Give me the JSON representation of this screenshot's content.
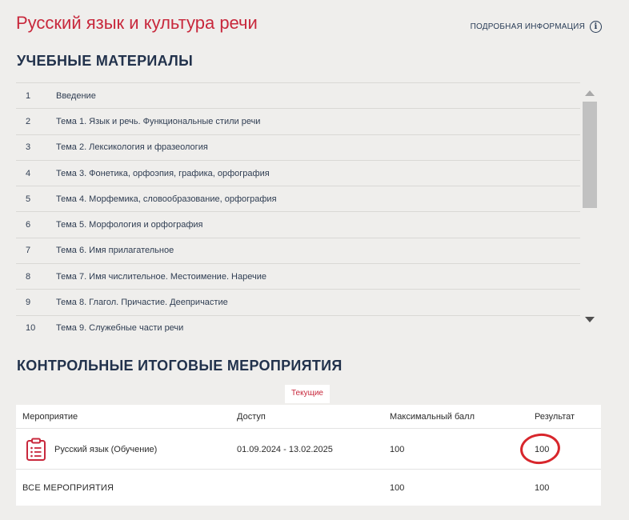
{
  "header": {
    "title": "Русский язык и культура речи",
    "info_label": "ПОДРОБНАЯ ИНФОРМАЦИЯ",
    "info_icon": "i"
  },
  "materials": {
    "title": "УЧЕБНЫЕ МАТЕРИАЛЫ",
    "items": [
      {
        "num": "1",
        "name": "Введение"
      },
      {
        "num": "2",
        "name": "Тема 1. Язык и речь. Функциональные стили речи"
      },
      {
        "num": "3",
        "name": "Тема 2. Лексикология и фразеология"
      },
      {
        "num": "4",
        "name": "Тема 3. Фонетика, орфоэпия, графика, орфография"
      },
      {
        "num": "5",
        "name": "Тема 4. Морфемика, словообразование, орфография"
      },
      {
        "num": "6",
        "name": "Тема 5. Морфология и орфография"
      },
      {
        "num": "7",
        "name": "Тема 6. Имя прилагательное"
      },
      {
        "num": "8",
        "name": "Тема 7. Имя числительное. Местоимение. Наречие"
      },
      {
        "num": "9",
        "name": "Тема 8. Глагол. Причастие. Деепричастие"
      },
      {
        "num": "10",
        "name": "Тема 9. Служебные части речи"
      }
    ]
  },
  "events": {
    "title": "КОНТРОЛЬНЫЕ ИТОГОВЫЕ МЕРОПРИЯТИЯ",
    "tab_label": "Текущие",
    "columns": [
      "Мероприятие",
      "Доступ",
      "Максимальный балл",
      "Результат"
    ],
    "rows": [
      {
        "name": "Русский язык (Обучение)",
        "access": "01.09.2024 - 13.02.2025",
        "max": "100",
        "result": "100"
      }
    ],
    "total": {
      "label": "ВСЕ МЕРОПРИЯТИЯ",
      "max": "100",
      "result": "100"
    }
  },
  "colors": {
    "accent": "#c8283c",
    "navy": "#22324c",
    "highlight_circle": "#d8262c"
  }
}
